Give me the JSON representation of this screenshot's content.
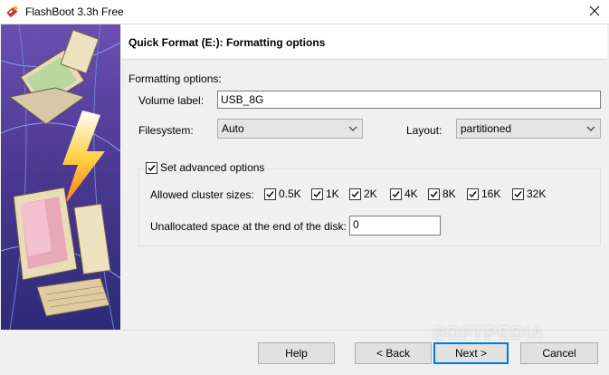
{
  "window": {
    "title": "FlashBoot 3.3h Free",
    "icon": "flashboot-app-icon",
    "close_icon": "close-icon"
  },
  "header": {
    "title": "Quick Format (E:): Formatting options"
  },
  "form": {
    "section_label": "Formatting options:",
    "volume_label": {
      "label": "Volume label:",
      "value": "USB_8G"
    },
    "filesystem": {
      "label": "Filesystem:",
      "value": "Auto"
    },
    "layout": {
      "label": "Layout:",
      "value": "partitioned"
    }
  },
  "advanced": {
    "label": "Set advanced options",
    "checked": true,
    "cluster_label": "Allowed cluster sizes:",
    "clusters": [
      {
        "label": "0.5K",
        "checked": true
      },
      {
        "label": "1K",
        "checked": true
      },
      {
        "label": "2K",
        "checked": true
      },
      {
        "label": "4K",
        "checked": true
      },
      {
        "label": "8K",
        "checked": true
      },
      {
        "label": "16K",
        "checked": true
      },
      {
        "label": "32K",
        "checked": true
      }
    ],
    "unallocated": {
      "label": "Unallocated space at the end of the disk:",
      "value": "0"
    }
  },
  "buttons": {
    "help": "Help",
    "back": "< Back",
    "next": "Next >",
    "cancel": "Cancel"
  },
  "watermark": "SOFTPEDIA"
}
